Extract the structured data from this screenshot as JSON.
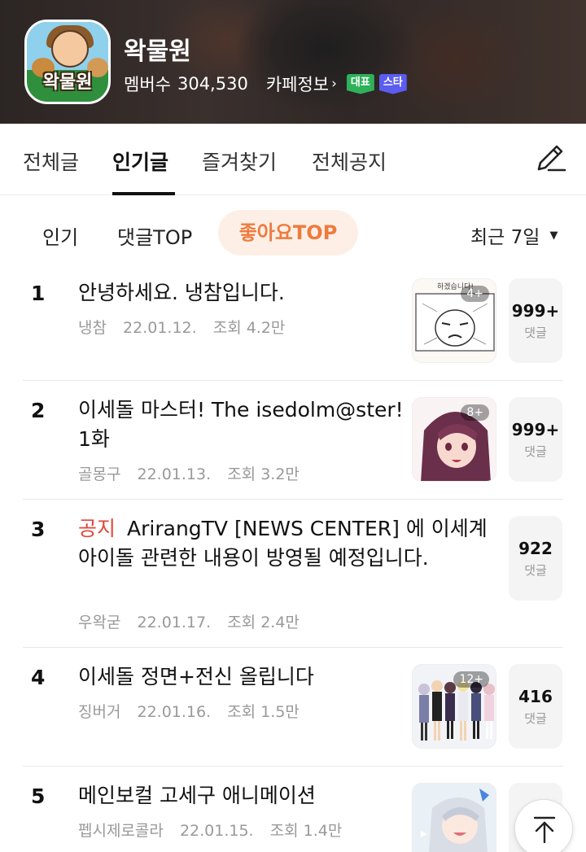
{
  "cafe": {
    "logo_text": "왁물원",
    "name": "왁물원",
    "member_label": "멤버수",
    "member_count": "304,530",
    "info_label": "카페정보",
    "badges": [
      "대표",
      "스타"
    ]
  },
  "main_tabs": [
    "전체글",
    "인기글",
    "즐겨찾기",
    "전체공지"
  ],
  "main_tabs_active": "인기글",
  "sub_tabs": [
    "인기",
    "댓글TOP",
    "좋아요TOP"
  ],
  "sub_tabs_active": "좋아요TOP",
  "period": "최근 7일",
  "posts": [
    {
      "rank": "1",
      "notice": "",
      "title": "안녕하세요. 냉참입니다.",
      "author": "냉참",
      "date": "22.01.12.",
      "views": "조회 4.2만",
      "thumb_count": "4+",
      "comments": "999+",
      "comment_label": "댓글"
    },
    {
      "rank": "2",
      "notice": "",
      "title": "이세돌 마스터! The isedolm@ster! 1화",
      "author": "골몽구",
      "date": "22.01.13.",
      "views": "조회 3.2만",
      "thumb_count": "8+",
      "comments": "999+",
      "comment_label": "댓글"
    },
    {
      "rank": "3",
      "notice": "공지",
      "title": "ArirangTV [NEWS CENTER] 에 이세계 아이돌 관련한 내용이 방영될 예정입니다.",
      "author": "우왁굳",
      "date": "22.01.17.",
      "views": "조회 2.4만",
      "thumb_count": "",
      "comments": "922",
      "comment_label": "댓글"
    },
    {
      "rank": "4",
      "notice": "",
      "title": "이세돌 정면+전신 올립니다",
      "author": "징버거",
      "date": "22.01.16.",
      "views": "조회 1.5만",
      "thumb_count": "12+",
      "comments": "416",
      "comment_label": "댓글"
    },
    {
      "rank": "5",
      "notice": "",
      "title": "메인보컬 고세구 애니메이션",
      "author": "펩시제로콜라",
      "date": "22.01.15.",
      "views": "조회 1.4만",
      "thumb_count": "",
      "comments": "",
      "comment_label": ""
    }
  ],
  "icons": {
    "write": "pencil-icon",
    "caret": "caret-down-icon",
    "top": "arrow-up-to-top-icon"
  },
  "colors": {
    "accent_orange": "#ee7b3e",
    "accent_bg": "#fdefe6",
    "notice_red": "#e0473c",
    "badge_green": "#2fb15a",
    "badge_purple": "#5b5cf0"
  }
}
